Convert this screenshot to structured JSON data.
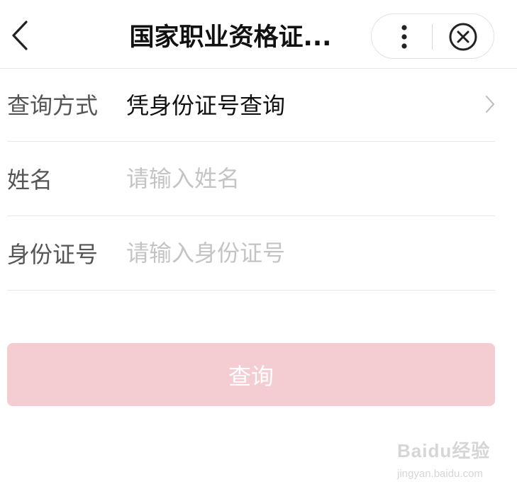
{
  "header": {
    "title": "国家职业资格证...",
    "back_icon": "back-arrow-icon",
    "more_icon": "more-vertical-icon",
    "close_icon": "close-circle-icon"
  },
  "form": {
    "method": {
      "label": "查询方式",
      "value": "凭身份证号查询",
      "icon": "chevron-right-icon"
    },
    "name": {
      "label": "姓名",
      "placeholder": "请输入姓名",
      "value": ""
    },
    "id_number": {
      "label": "身份证号",
      "placeholder": "请输入身份证号",
      "value": ""
    }
  },
  "submit": {
    "label": "查询",
    "color": "#f3cdd2"
  },
  "watermark": {
    "brand": "Baidu经验",
    "url": "jingyan.baidu.com"
  }
}
